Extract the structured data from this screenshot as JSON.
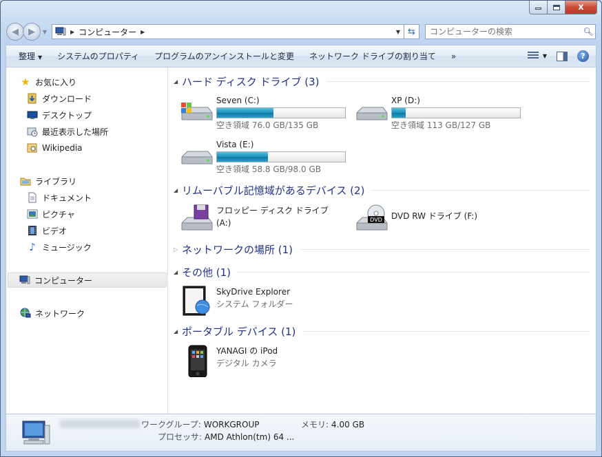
{
  "window": {
    "caption_min": "",
    "caption_max": "",
    "caption_close": "x"
  },
  "address": {
    "crumb": "コンピューター",
    "search_placeholder": "コンピューターの検索"
  },
  "toolbar": {
    "organize": "整理",
    "system_properties": "システムのプロパティ",
    "uninstall": "プログラムのアンインストールと変更",
    "map_drive": "ネットワーク ドライブの割り当て",
    "more": "»",
    "help": "?"
  },
  "sidebar": {
    "favorites": "お気に入り",
    "downloads": "ダウンロード",
    "desktop": "デスクトップ",
    "recent": "最近表示した場所",
    "wikipedia": "Wikipedia",
    "libraries": "ライブラリ",
    "documents": "ドキュメント",
    "pictures": "ピクチャ",
    "videos": "ビデオ",
    "music": "ミュージック",
    "computer": "コンピューター",
    "network": "ネットワーク"
  },
  "groups": {
    "hdd": "ハード ディスク ドライブ (3)",
    "removable": "リムーバブル記憶域があるデバイス (2)",
    "network": "ネットワークの場所 (1)",
    "other": "その他 (1)",
    "portable": "ポータブル デバイス (1)"
  },
  "drives": [
    {
      "name": "Seven (C:)",
      "free": "空き領域 76.0 GB/135 GB",
      "used_fraction": 0.44
    },
    {
      "name": "XP (D:)",
      "free": "空き領域 113 GB/127 GB",
      "used_fraction": 0.11
    },
    {
      "name": "Vista (E:)",
      "free": "空き領域 58.8 GB/98.0 GB",
      "used_fraction": 0.4
    }
  ],
  "removable": {
    "floppy_line1": "フロッピー ディスク ドライブ",
    "floppy_line2": "(A:)",
    "dvd": "DVD RW ドライブ (F:)",
    "dvd_badge": "DVD"
  },
  "other": {
    "skydrive": "SkyDrive Explorer",
    "skydrive_sub": "システム フォルダー"
  },
  "portable": {
    "ipod": "YANAGI の iPod",
    "ipod_sub": "デジタル カメラ"
  },
  "details": {
    "workgroup_label": "ワークグループ:",
    "workgroup_value": "WORKGROUP",
    "memory_label": "メモリ:",
    "memory_value": "4.00 GB",
    "cpu_label": "プロセッサ:",
    "cpu_value": "AMD Athlon(tm) 64 ..."
  },
  "colors": {
    "group_heading": "#1e3287",
    "bar_fill": "#1a8fb9"
  }
}
